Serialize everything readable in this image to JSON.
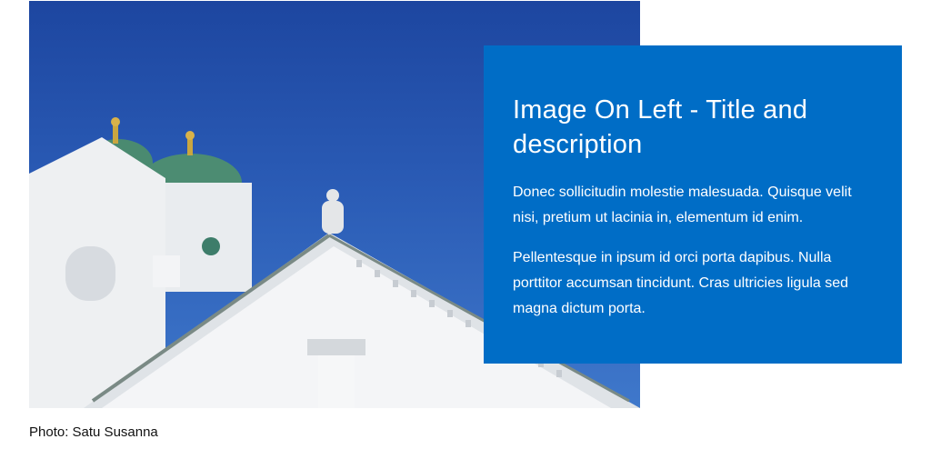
{
  "image": {
    "alt_icon": "cathedral-photo",
    "caption": "Photo: Satu Susanna"
  },
  "card": {
    "title": "Image On Left - Title and description",
    "paragraphs": [
      "Donec sollicitudin molestie malesuada. Quisque velit nisi, pretium ut lacinia in, elementum id enim.",
      "Pellentesque in ipsum id orci porta dapibus. Nulla porttitor accumsan tincidunt. Cras ultricies ligula sed magna dictum porta."
    ],
    "background": "#006dc6"
  }
}
